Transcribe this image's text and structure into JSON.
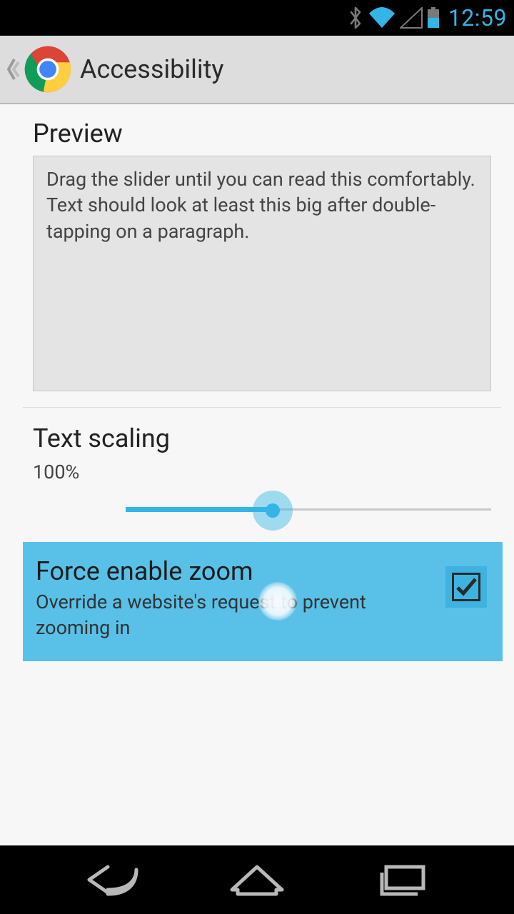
{
  "status": {
    "clock": "12:59"
  },
  "header": {
    "title": "Accessibility"
  },
  "preview": {
    "title": "Preview",
    "text": "Drag the slider until you can read this comfortably. Text should look at least this big after double-tapping on a paragraph."
  },
  "scaling": {
    "title": "Text scaling",
    "value": "100%",
    "percent": 100
  },
  "zoom": {
    "title": "Force enable zoom",
    "subtitle": "Override a website's request to prevent zooming in",
    "checked": true
  }
}
